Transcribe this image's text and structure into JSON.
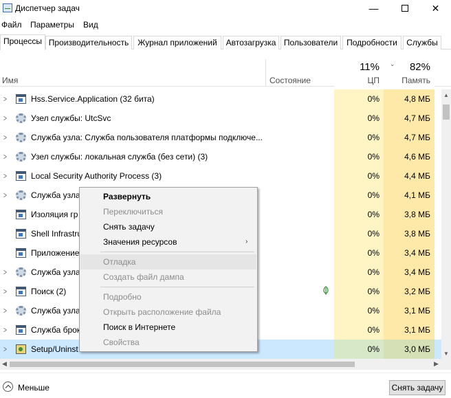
{
  "window": {
    "title": "Диспетчер задач",
    "minimize_glyph": "—",
    "close_glyph": "✕"
  },
  "menu": [
    "Файл",
    "Параметры",
    "Вид"
  ],
  "tabs": [
    {
      "label": "Процессы",
      "active": true
    },
    {
      "label": "Производительность"
    },
    {
      "label": "Журнал приложений"
    },
    {
      "label": "Автозагрузка"
    },
    {
      "label": "Пользователи"
    },
    {
      "label": "Подробности"
    },
    {
      "label": "Службы"
    }
  ],
  "columns": {
    "name": "Имя",
    "status": "Состояние",
    "cpu_pct": "11%",
    "cpu": "ЦП",
    "mem_pct": "82%",
    "mem": "Память",
    "sort_glyph": "⌄"
  },
  "rows": [
    {
      "icon": "window-icon",
      "name": "Hss.Service.Application (32 бита)",
      "cpu": "0%",
      "mem": "4,8 МБ"
    },
    {
      "icon": "gear-icon",
      "name": "Узел службы: UtcSvc",
      "cpu": "0%",
      "mem": "4,7 МБ"
    },
    {
      "icon": "gear-icon",
      "name": "Служба узла: Служба пользователя платформы подключе...",
      "cpu": "0%",
      "mem": "4,7 МБ"
    },
    {
      "icon": "gear-icon",
      "name": "Узел службы: локальная служба (без сети) (3)",
      "cpu": "0%",
      "mem": "4,6 МБ"
    },
    {
      "icon": "window-icon",
      "name": "Local Security Authority Process (3)",
      "cpu": "0%",
      "mem": "4,4 МБ"
    },
    {
      "icon": "gear-icon",
      "name": "Служба узла",
      "cpu": "0%",
      "mem": "4,1 МБ"
    },
    {
      "icon": "window-icon",
      "name": "Изоляция гр",
      "cpu": "0%",
      "mem": "3,8 МБ"
    },
    {
      "icon": "window-icon",
      "name": "Shell Infrastru",
      "cpu": "0%",
      "mem": "3,8 МБ"
    },
    {
      "icon": "window-icon",
      "name": "Приложение",
      "cpu": "0%",
      "mem": "3,4 МБ"
    },
    {
      "icon": "gear-icon",
      "name": "Служба узла",
      "cpu": "0%",
      "mem": "3,4 МБ"
    },
    {
      "icon": "window-icon",
      "name": "Поиск (2)",
      "cpu": "0%",
      "mem": "3,2 МБ"
    },
    {
      "icon": "gear-icon",
      "name": "Служба узла",
      "cpu": "0%",
      "mem": "3,1 МБ"
    },
    {
      "icon": "window-icon",
      "name": "Служба брок",
      "cpu": "0%",
      "mem": "3,1 МБ"
    },
    {
      "icon": "setup-icon",
      "name": "Setup/Uninst",
      "cpu": "0%",
      "mem": "3,0 МБ",
      "selected": true
    }
  ],
  "expand_glyph": ">",
  "context_menu": {
    "items": [
      {
        "label": "Развернуть",
        "bold": true
      },
      {
        "label": "Переключиться",
        "disabled": true
      },
      {
        "label": "Снять задачу"
      },
      {
        "label": "Значения ресурсов",
        "submenu": true
      },
      {
        "label": "Отладка",
        "disabled": true,
        "hover": true
      },
      {
        "label": "Создать файл дампа",
        "disabled": true
      },
      {
        "label": "Подробно",
        "disabled": true
      },
      {
        "label": "Открыть расположение файла",
        "disabled": true
      },
      {
        "label": "Поиск в Интернете"
      },
      {
        "label": "Свойства",
        "disabled": true
      }
    ],
    "submenu_glyph": "›"
  },
  "footer": {
    "less_label": "Меньше",
    "end_task_label": "Снять задачу"
  },
  "scroll_glyphs": {
    "up": "▲",
    "down": "▼",
    "left": "◀",
    "right": "▶"
  }
}
